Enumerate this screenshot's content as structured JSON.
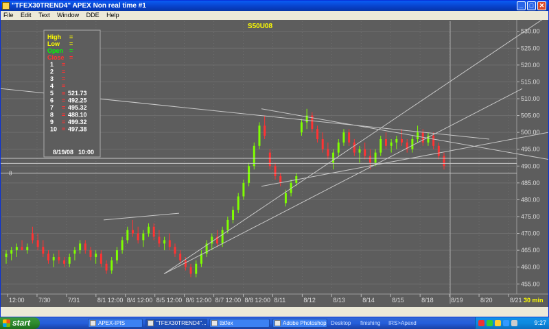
{
  "window": {
    "title": "\"TFEX30TREND4\" APEX Non real time #1",
    "menu": [
      "File",
      "Edit",
      "Text",
      "Window",
      "DDE",
      "Help"
    ],
    "controls": {
      "minimize": "_",
      "maximize": "□",
      "close": "✕"
    }
  },
  "chart": {
    "symbol": "S50U08",
    "background": "#5d5d5d",
    "grid_color": "#6e6e6e",
    "up_color": "#7fff00",
    "down_color": "#ff3333",
    "line_color": "#c8c8c8",
    "interval_label": "30 min",
    "left_marker": "8",
    "info_box": {
      "labels": [
        {
          "text": "High",
          "value": "=",
          "color": "#ffff00"
        },
        {
          "text": "Low",
          "value": "=",
          "color": "#ffff00"
        },
        {
          "text": "Open",
          "value": "=",
          "color": "#00ff00"
        },
        {
          "text": "Close",
          "value": "=",
          "color": "#ff3333"
        }
      ],
      "rows": [
        {
          "n": "1",
          "eq": "=",
          "val": ""
        },
        {
          "n": "2",
          "eq": "=",
          "val": ""
        },
        {
          "n": "3",
          "eq": "=",
          "val": ""
        },
        {
          "n": "4",
          "eq": "=",
          "val": ""
        },
        {
          "n": "5",
          "eq": "=",
          "val": "521.73"
        },
        {
          "n": "6",
          "eq": "=",
          "val": "492.25"
        },
        {
          "n": "7",
          "eq": "=",
          "val": "495.32"
        },
        {
          "n": "8",
          "eq": "=",
          "val": "488.10"
        },
        {
          "n": "9",
          "eq": "=",
          "val": "499.32"
        },
        {
          "n": "10",
          "eq": "=",
          "val": "497.38"
        }
      ],
      "date": "8/19/08",
      "time": "10:00"
    },
    "y_axis_labels": [
      "530.00",
      "525.00",
      "520.00",
      "515.00",
      "510.00",
      "505.00",
      "500.00",
      "495.00",
      "490.00",
      "485.00",
      "480.00",
      "475.00",
      "470.00",
      "465.00",
      "460.00",
      "455.00"
    ],
    "x_axis_labels": [
      "12:00",
      "7/30",
      "7/31",
      "8/1 12:00",
      "8/4 12:00",
      "8/5 12:00",
      "8/6 12:00",
      "8/7 12:00",
      "8/8 12:00",
      "8/11",
      "8/12",
      "8/13",
      "8/14",
      "8/15",
      "8/18",
      "8/19",
      "8/20",
      "8/21"
    ]
  },
  "chart_data": {
    "type": "candlestick",
    "title": "S50U08",
    "ylim": [
      452,
      533
    ],
    "candles": [
      {
        "o": 463,
        "h": 465,
        "l": 461,
        "c": 464
      },
      {
        "o": 464,
        "h": 466,
        "l": 462,
        "c": 465
      },
      {
        "o": 465,
        "h": 467,
        "l": 463,
        "c": 466
      },
      {
        "o": 466,
        "h": 468,
        "l": 465,
        "c": 465
      },
      {
        "o": 465,
        "h": 467,
        "l": 464,
        "c": 466
      },
      {
        "o": 470,
        "h": 472,
        "l": 467,
        "c": 468
      },
      {
        "o": 468,
        "h": 470,
        "l": 465,
        "c": 466
      },
      {
        "o": 466,
        "h": 468,
        "l": 463,
        "c": 464
      },
      {
        "o": 464,
        "h": 465,
        "l": 461,
        "c": 462
      },
      {
        "o": 462,
        "h": 464,
        "l": 460,
        "c": 463
      },
      {
        "o": 463,
        "h": 465,
        "l": 461,
        "c": 462
      },
      {
        "o": 462,
        "h": 463,
        "l": 460,
        "c": 461
      },
      {
        "o": 461,
        "h": 464,
        "l": 460,
        "c": 463
      },
      {
        "o": 464,
        "h": 466,
        "l": 462,
        "c": 465
      },
      {
        "o": 465,
        "h": 468,
        "l": 464,
        "c": 467
      },
      {
        "o": 467,
        "h": 468,
        "l": 464,
        "c": 465
      },
      {
        "o": 465,
        "h": 466,
        "l": 462,
        "c": 463
      },
      {
        "o": 463,
        "h": 465,
        "l": 461,
        "c": 464
      },
      {
        "o": 464,
        "h": 465,
        "l": 460,
        "c": 461
      },
      {
        "o": 461,
        "h": 462,
        "l": 458,
        "c": 459
      },
      {
        "o": 459,
        "h": 463,
        "l": 458,
        "c": 462
      },
      {
        "o": 462,
        "h": 466,
        "l": 461,
        "c": 465
      },
      {
        "o": 465,
        "h": 469,
        "l": 464,
        "c": 468
      },
      {
        "o": 468,
        "h": 472,
        "l": 467,
        "c": 471
      },
      {
        "o": 471,
        "h": 474,
        "l": 469,
        "c": 470
      },
      {
        "o": 470,
        "h": 472,
        "l": 467,
        "c": 468
      },
      {
        "o": 468,
        "h": 471,
        "l": 466,
        "c": 470
      },
      {
        "o": 470,
        "h": 473,
        "l": 469,
        "c": 472
      },
      {
        "o": 472,
        "h": 473,
        "l": 468,
        "c": 469
      },
      {
        "o": 469,
        "h": 471,
        "l": 466,
        "c": 467
      },
      {
        "o": 467,
        "h": 469,
        "l": 465,
        "c": 468
      },
      {
        "o": 468,
        "h": 470,
        "l": 465,
        "c": 466
      },
      {
        "o": 466,
        "h": 467,
        "l": 463,
        "c": 464
      },
      {
        "o": 464,
        "h": 465,
        "l": 461,
        "c": 462
      },
      {
        "o": 462,
        "h": 463,
        "l": 459,
        "c": 460
      },
      {
        "o": 460,
        "h": 461,
        "l": 457,
        "c": 458
      },
      {
        "o": 458,
        "h": 462,
        "l": 457,
        "c": 461
      },
      {
        "o": 461,
        "h": 465,
        "l": 460,
        "c": 464
      },
      {
        "o": 464,
        "h": 468,
        "l": 463,
        "c": 467
      },
      {
        "o": 467,
        "h": 470,
        "l": 465,
        "c": 469
      },
      {
        "o": 469,
        "h": 471,
        "l": 466,
        "c": 467
      },
      {
        "o": 467,
        "h": 472,
        "l": 466,
        "c": 471
      },
      {
        "o": 471,
        "h": 475,
        "l": 470,
        "c": 474
      },
      {
        "o": 474,
        "h": 478,
        "l": 473,
        "c": 477
      },
      {
        "o": 477,
        "h": 482,
        "l": 476,
        "c": 481
      },
      {
        "o": 481,
        "h": 486,
        "l": 480,
        "c": 485
      },
      {
        "o": 485,
        "h": 491,
        "l": 484,
        "c": 490
      },
      {
        "o": 490,
        "h": 497,
        "l": 489,
        "c": 496
      },
      {
        "o": 496,
        "h": 503,
        "l": 495,
        "c": 502
      },
      {
        "o": 502,
        "h": 505,
        "l": 498,
        "c": 499
      },
      {
        "o": 494,
        "h": 495,
        "l": 489,
        "c": 490
      },
      {
        "o": 490,
        "h": 491,
        "l": 486,
        "c": 487
      },
      {
        "o": 487,
        "h": 488,
        "l": 484,
        "c": 485
      },
      {
        "o": 479,
        "h": 483,
        "l": 478,
        "c": 482
      },
      {
        "o": 482,
        "h": 486,
        "l": 481,
        "c": 485
      },
      {
        "o": 485,
        "h": 488,
        "l": 484,
        "c": 487
      },
      {
        "o": 500,
        "h": 504,
        "l": 499,
        "c": 503
      },
      {
        "o": 503,
        "h": 507,
        "l": 501,
        "c": 505
      },
      {
        "o": 505,
        "h": 506,
        "l": 500,
        "c": 501
      },
      {
        "o": 501,
        "h": 502,
        "l": 497,
        "c": 498
      },
      {
        "o": 498,
        "h": 500,
        "l": 494,
        "c": 495
      },
      {
        "o": 495,
        "h": 497,
        "l": 492,
        "c": 493
      },
      {
        "o": 491,
        "h": 495,
        "l": 489,
        "c": 494
      },
      {
        "o": 494,
        "h": 498,
        "l": 493,
        "c": 497
      },
      {
        "o": 497,
        "h": 501,
        "l": 496,
        "c": 500
      },
      {
        "o": 500,
        "h": 501,
        "l": 496,
        "c": 497
      },
      {
        "o": 497,
        "h": 498,
        "l": 493,
        "c": 494
      },
      {
        "o": 494,
        "h": 496,
        "l": 491,
        "c": 495
      },
      {
        "o": 495,
        "h": 497,
        "l": 492,
        "c": 493
      },
      {
        "o": 493,
        "h": 495,
        "l": 489,
        "c": 491
      },
      {
        "o": 491,
        "h": 495,
        "l": 490,
        "c": 494
      },
      {
        "o": 494,
        "h": 499,
        "l": 493,
        "c": 498
      },
      {
        "o": 498,
        "h": 500,
        "l": 495,
        "c": 496
      },
      {
        "o": 496,
        "h": 498,
        "l": 494,
        "c": 497
      },
      {
        "o": 497,
        "h": 499,
        "l": 495,
        "c": 498
      },
      {
        "o": 498,
        "h": 501,
        "l": 496,
        "c": 497
      },
      {
        "o": 497,
        "h": 498,
        "l": 494,
        "c": 495
      },
      {
        "o": 495,
        "h": 499,
        "l": 494,
        "c": 498
      },
      {
        "o": 498,
        "h": 502,
        "l": 497,
        "c": 500
      },
      {
        "o": 500,
        "h": 501,
        "l": 496,
        "c": 497
      },
      {
        "o": 497,
        "h": 500,
        "l": 496,
        "c": 499
      },
      {
        "o": 499,
        "h": 500,
        "l": 495,
        "c": 496
      },
      {
        "o": 496,
        "h": 497,
        "l": 492,
        "c": 493
      },
      {
        "o": 493,
        "h": 494,
        "l": 489,
        "c": 490
      }
    ]
  },
  "taskbar": {
    "start_label": "start",
    "tasks": [
      {
        "label": "APEX-IPIS",
        "active": false
      },
      {
        "label": "\"TFEX30TREND4\"...",
        "active": true
      },
      {
        "label": "tbtfex",
        "active": false
      },
      {
        "label": "Adobe Photoshop",
        "active": false
      }
    ],
    "quick_links": [
      "Desktop",
      "finishing",
      "IRS>Apexd"
    ],
    "clock": "9:27"
  }
}
